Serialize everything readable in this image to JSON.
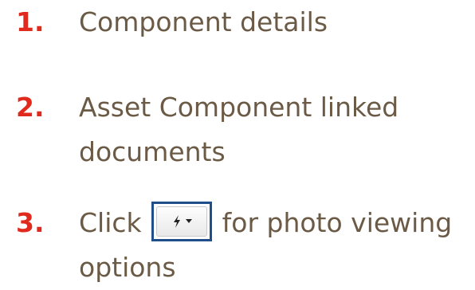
{
  "steps": [
    {
      "number": "1.",
      "text": "Component details"
    },
    {
      "number": "2.",
      "text": "Asset Component linked documents"
    },
    {
      "number": "3.",
      "text_before": "Click",
      "text_after": "for photo viewing options"
    }
  ],
  "colors": {
    "number": "#e02a1e",
    "text": "#6b5a45",
    "button_highlight": "#1f4e8a"
  },
  "icons": {
    "photo_options_button": [
      "bolt-icon",
      "caret-down-icon"
    ]
  }
}
